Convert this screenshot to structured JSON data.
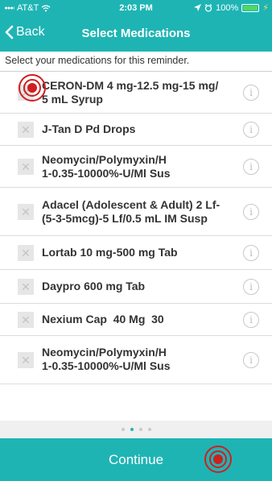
{
  "status_bar": {
    "carrier": "AT&T",
    "time": "2:03 PM",
    "battery": "100%"
  },
  "nav": {
    "back_label": "Back",
    "title": "Select Medications"
  },
  "instruction": "Select your medications for this reminder.",
  "medications": [
    {
      "line1": "CERON-DM 4 mg-12.5 mg-15 mg/",
      "line2": "5 mL Syrup"
    },
    {
      "line1": "J-Tan D Pd Drops",
      "line2": ""
    },
    {
      "line1": "Neomycin/Polymyxin/H",
      "line2": "1-0.35-10000%-U/Ml Sus"
    },
    {
      "line1": "Adacel (Adolescent & Adult) 2 Lf-",
      "line2": "(5-3-5mcg)-5 Lf/0.5 mL IM Susp"
    },
    {
      "line1": "Lortab 10 mg-500 mg Tab",
      "line2": ""
    },
    {
      "line1": "Daypro 600 mg Tab",
      "line2": ""
    },
    {
      "line1": "Nexium Cap  40 Mg  30",
      "line2": ""
    },
    {
      "line1": "Neomycin/Polymyxin/H",
      "line2": "1-0.35-10000%-U/Ml Sus"
    }
  ],
  "checkbox_glyph": "✕",
  "info_glyph": "i",
  "pager": {
    "pages": 4,
    "active_page": 2
  },
  "continue_label": "Continue",
  "colors": {
    "accent": "#1fb4b4",
    "marker": "#d01f1f"
  },
  "icons": [
    "wifi-icon",
    "back-chevron-icon",
    "location-icon",
    "alarm-icon",
    "battery-icon",
    "checkbox-icon",
    "info-icon",
    "tap-target-icon"
  ]
}
